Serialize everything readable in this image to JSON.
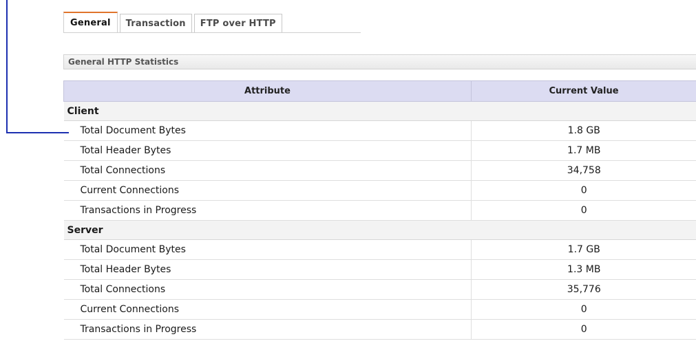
{
  "tabs": [
    {
      "label": "General",
      "active": true
    },
    {
      "label": "Transaction",
      "active": false
    },
    {
      "label": "FTP over HTTP",
      "active": false
    }
  ],
  "section_title": "General HTTP Statistics",
  "table": {
    "headers": {
      "attribute": "Attribute",
      "value": "Current Value"
    },
    "groups": [
      {
        "name": "Client",
        "rows": [
          {
            "attribute": "Total Document Bytes",
            "value": "1.8 GB"
          },
          {
            "attribute": "Total Header Bytes",
            "value": "1.7 MB"
          },
          {
            "attribute": "Total Connections",
            "value": "34,758"
          },
          {
            "attribute": "Current Connections",
            "value": "0"
          },
          {
            "attribute": "Transactions in Progress",
            "value": "0"
          }
        ]
      },
      {
        "name": "Server",
        "rows": [
          {
            "attribute": "Total Document Bytes",
            "value": "1.7 GB"
          },
          {
            "attribute": "Total Header Bytes",
            "value": "1.3 MB"
          },
          {
            "attribute": "Total Connections",
            "value": "35,776"
          },
          {
            "attribute": "Current Connections",
            "value": "0"
          },
          {
            "attribute": "Transactions in Progress",
            "value": "0"
          }
        ]
      }
    ]
  },
  "colors": {
    "active_tab_accent": "#e0742b",
    "header_bg": "#dcdcf2",
    "callout_line": "#1c2fb0"
  }
}
